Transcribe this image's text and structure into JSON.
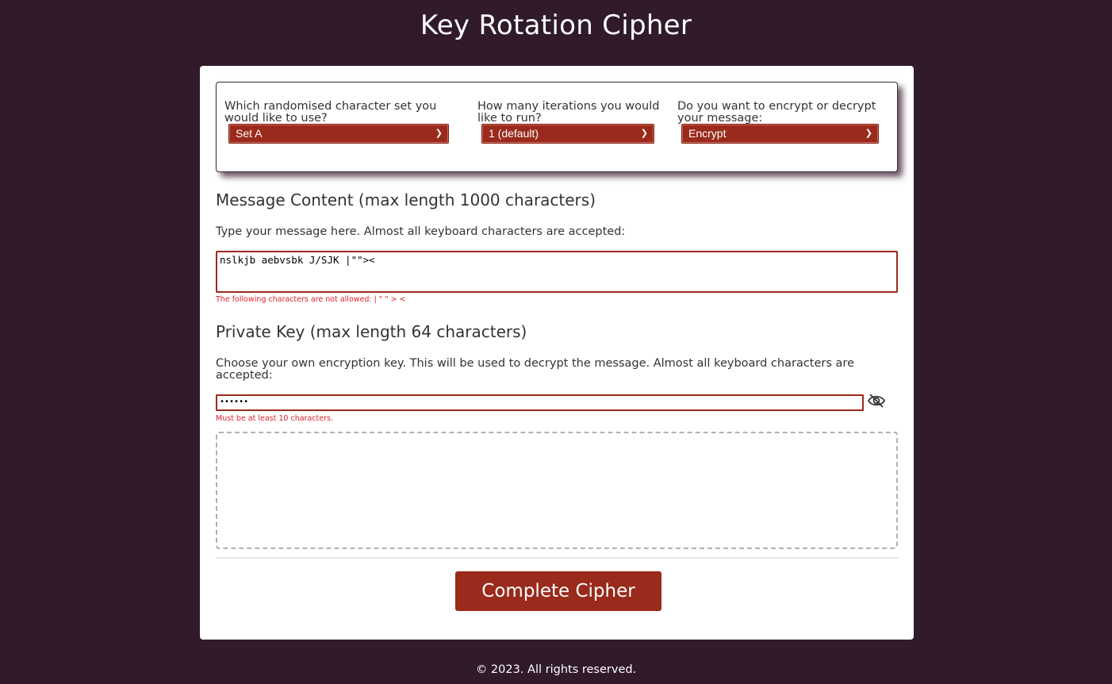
{
  "header": {
    "title": "Key Rotation Cipher"
  },
  "options": {
    "charset": {
      "label": "Which randomised character set you would like to use?",
      "selected": "Set A"
    },
    "iterations": {
      "label": "How many iterations you would like to run?",
      "selected": "1 (default)"
    },
    "mode": {
      "label": "Do you want to encrypt or decrypt your message:",
      "selected": "Encrypt"
    }
  },
  "message": {
    "heading": "Message Content (max length 1000 characters)",
    "description": "Type your message here. Almost all keyboard characters are accepted:",
    "value": "nslkjb aebvsbk J/SJK |\"\"><",
    "error": "The following characters are not allowed: | \" \" > <"
  },
  "key": {
    "heading": "Private Key (max length 64 characters)",
    "description": "Choose your own encryption key. This will be used to decrypt the message. Almost all keyboard characters are accepted:",
    "masked_value": "••••••",
    "error": "Must be at least 10 characters.",
    "toggle_icon": "eye-slash-icon"
  },
  "actions": {
    "submit_label": "Complete Cipher"
  },
  "footer": {
    "copyright": "© 2023. All rights reserved."
  },
  "colors": {
    "background": "#301a2b",
    "accent": "#992a1c",
    "error": "#e0202a"
  }
}
